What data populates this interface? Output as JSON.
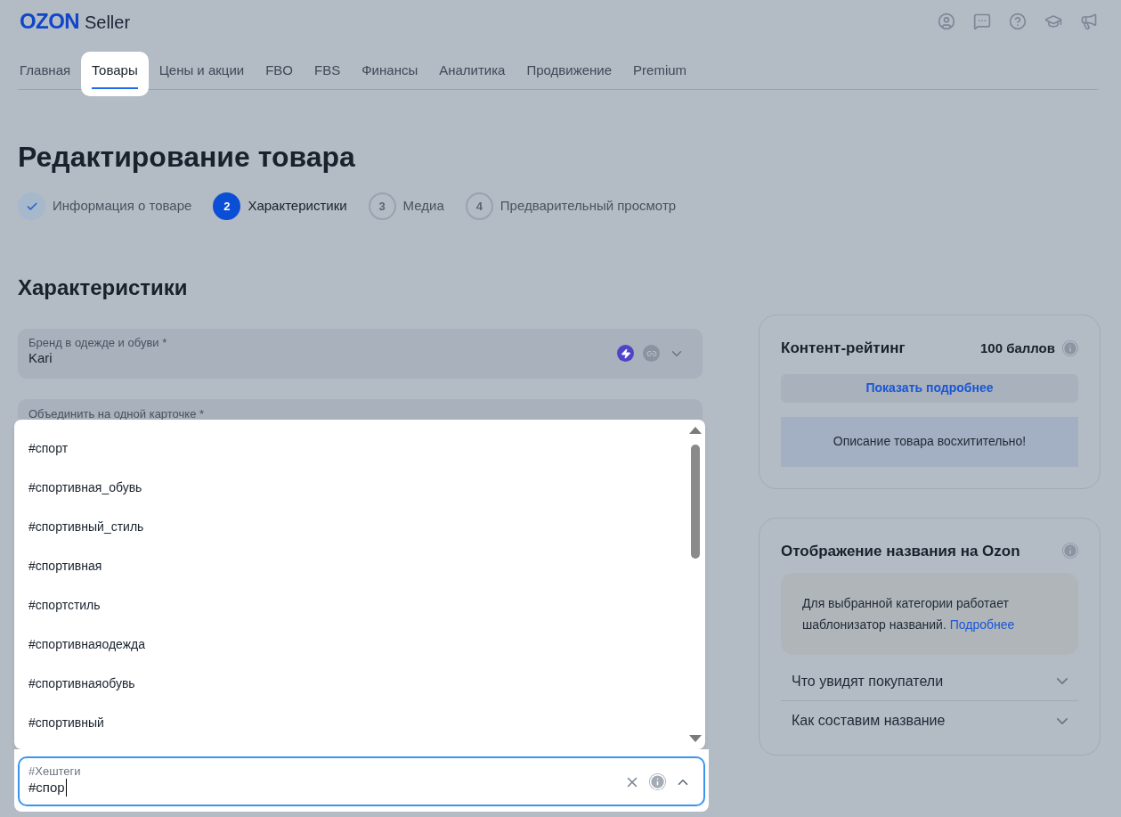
{
  "header": {
    "logo": "OZON",
    "logo_suffix": "Seller"
  },
  "nav_tabs": [
    {
      "label": "Главная",
      "selected": false
    },
    {
      "label": "Товары",
      "selected": true
    },
    {
      "label": "Цены и акции",
      "selected": false
    },
    {
      "label": "FBO",
      "selected": false
    },
    {
      "label": "FBS",
      "selected": false
    },
    {
      "label": "Финансы",
      "selected": false
    },
    {
      "label": "Аналитика",
      "selected": false
    },
    {
      "label": "Продвижение",
      "selected": false
    },
    {
      "label": "Premium",
      "selected": false
    }
  ],
  "page_title": "Редактирование товара",
  "steps": [
    {
      "label": "Информация о товаре",
      "kind": "done"
    },
    {
      "marker": "2",
      "label": "Характеристики",
      "kind": "current"
    },
    {
      "marker": "3",
      "label": "Медиа",
      "kind": "todo"
    },
    {
      "marker": "4",
      "label": "Предварительный просмотр",
      "kind": "todo"
    }
  ],
  "section_title": "Характеристики",
  "fields": [
    {
      "label": "Бренд в одежде и обуви *",
      "value": "Kari"
    },
    {
      "label": "Объединить на одной карточке *"
    }
  ],
  "dropdown": {
    "options": [
      "#спорт",
      "#спортивная_обувь",
      "#спортивный_стиль",
      "#спортивная",
      "#спортстиль",
      "#спортивнаяодежда",
      "#спортивнаяобувь",
      "#спортивный"
    ]
  },
  "hashtag_field": {
    "label": "#Хештеги",
    "value": "#спор"
  },
  "content_rating": {
    "title": "Контент-рейтинг",
    "score": "100 баллов",
    "button": "Показать подробнее",
    "banner": "Описание товара восхитительно!"
  },
  "name_display": {
    "title": "Отображение названия на Ozon",
    "note": "Для выбранной категории работает шаблонизатор названий.",
    "link": "Подробнее",
    "sections": [
      {
        "label": "Что увидят покупатели",
        "expanded": false
      },
      {
        "label": "Как составим название",
        "expanded": false
      }
    ]
  }
}
